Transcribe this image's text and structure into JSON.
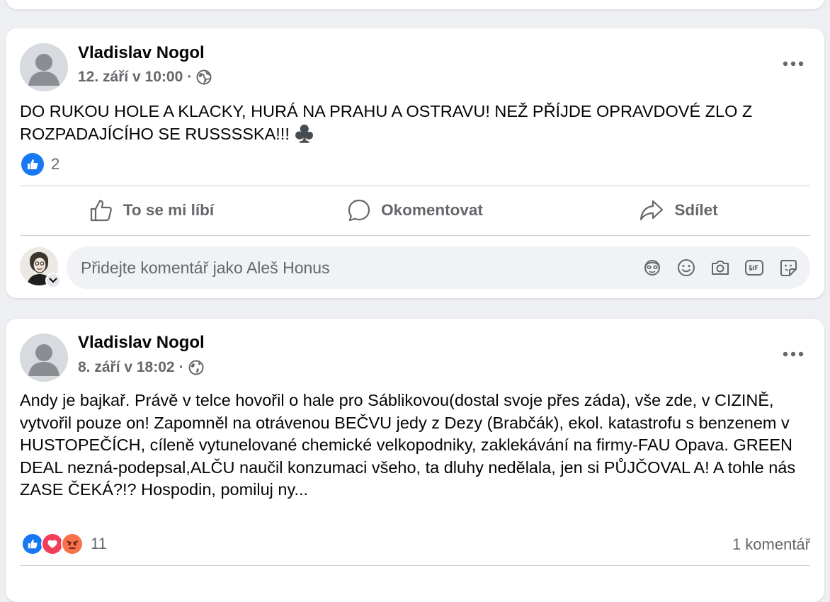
{
  "posts": [
    {
      "author": "Vladislav Nogol",
      "timestamp": "12. září v 10:00",
      "separator": "·",
      "text": "DO RUKOU HOLE A KLACKY, HURÁ NA PRAHU A OSTRAVU! NEŽ PŘÍJDE OPRAVDOVÉ ZLO Z ROZPADAJÍCÍHO SE RUSSSSKA!!! ♣️",
      "reaction_count": "2",
      "reactions": [
        "like"
      ]
    },
    {
      "author": "Vladislav Nogol",
      "timestamp": "8. září v 18:02",
      "separator": "·",
      "text": "Andy je bajkař. Právě v telce hovořil o hale pro Sáblikovou(dostal svoje přes záda), vše zde, v CIZINĚ, vytvořil pouze on! Zapomněl na otrávenou BEČVU jedy z Dezy (Brabčák), ekol. katastrofu s benzenem v HUSTOPEČÍCH, cíleně vytunelované chemické velkopodniky, zaklekávání na firmy-FAU Opava. GREEN DEAL nezná-podepsal,ALČU naučil konzumaci všeho, ta dluhy nedělala, jen si PŮJČOVAL A! A tohle nás ZASE ČEKÁ?!? Hospodin, pomiluj ny...",
      "reaction_count": "11",
      "comment_count": "1 komentář",
      "reactions": [
        "like",
        "love",
        "angry"
      ]
    }
  ],
  "actions": {
    "like": "To se mi líbí",
    "comment": "Okomentovat",
    "share": "Sdílet"
  },
  "comment_box": {
    "placeholder": "Přidejte komentář jako Aleš Honus"
  },
  "icons": {
    "privacy": "globe-icon",
    "more": "more-dots-icon",
    "comment_tools": [
      "avatar-sticker-icon",
      "emoji-icon",
      "camera-icon",
      "gif-icon",
      "sticker-icon"
    ]
  },
  "colors": {
    "like_blue": "#1877f2",
    "love_red": "#f33e58",
    "angry_orange": "#f7714b",
    "secondary_text": "#65676b"
  }
}
